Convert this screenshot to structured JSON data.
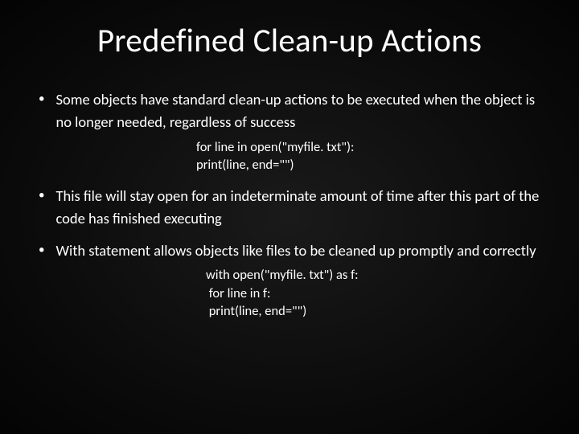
{
  "title": "Predefined Clean-up Actions",
  "bullets": {
    "b1": "Some objects have standard clean-up actions to be executed when the object is no longer needed, regardless of success",
    "b2": "This file will stay open for an indeterminate amount of time after this part of the code has finished executing",
    "b3": "With statement allows objects like files to be cleaned up promptly and correctly"
  },
  "code": {
    "c1_l1": "for line in open(\"myfile. txt\"):",
    "c1_l2": "print(line, end=\"\")",
    "c2_l1": "with open(\"myfile. txt\") as f:",
    "c2_l2": " for line in f:",
    "c2_l3": " print(line, end=\"\")"
  }
}
